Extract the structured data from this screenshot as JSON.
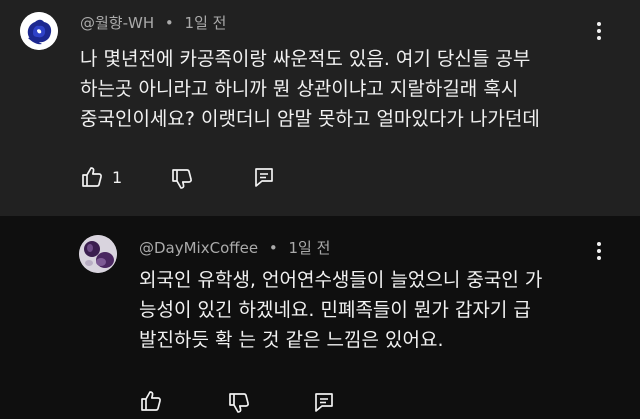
{
  "comments": [
    {
      "author": "@월향-WH",
      "time": "1일 전",
      "lines": [
        "나 몇년전에 카공족이랑 싸운적도 있음. 여기 당신들 공부",
        "하는곳 아니라고 하니까 뭔 상관이냐고 지랄하길래 혹시",
        "중국인이세요? 이랫더니 암말 못하고 얼마있다가 나가던데"
      ],
      "like_count": "1",
      "avatar_icon": "rose-icon"
    },
    {
      "author": "@DayMixCoffee",
      "time": "1일 전",
      "lines": [
        "외국인 유학생, 언어연수생들이 늘었으니 중국인 가",
        "능성이 있긴 하겠네요. 민폐족들이 뭔가 갑자기 급",
        "발진하듯 확 는 것 같은 느낌은 있어요."
      ],
      "like_count": "",
      "avatar_icon": "purple-objects-icon"
    }
  ],
  "separator": "•",
  "colors": {
    "top_background": "#212121",
    "reply_background": "#0f0f0f",
    "text": "#f1f1f1",
    "meta": "#aaaaaa"
  }
}
